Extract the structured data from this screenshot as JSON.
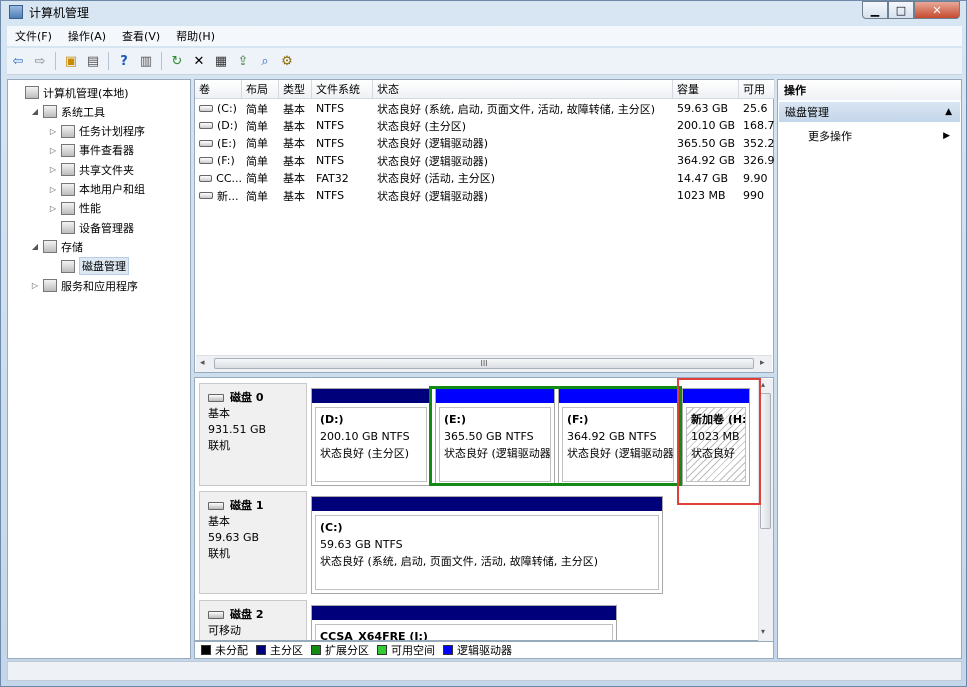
{
  "window": {
    "title": "计算机管理"
  },
  "menu": [
    "文件(F)",
    "操作(A)",
    "查看(V)",
    "帮助(H)"
  ],
  "tree": [
    {
      "label": "计算机管理(本地)",
      "indent": 0,
      "expander": "",
      "icon": "computer-management-icon"
    },
    {
      "label": "系统工具",
      "indent": 1,
      "expander": "◢",
      "icon": "system-tools-icon"
    },
    {
      "label": "任务计划程序",
      "indent": 2,
      "expander": "▷",
      "icon": "task-scheduler-icon"
    },
    {
      "label": "事件查看器",
      "indent": 2,
      "expander": "▷",
      "icon": "event-viewer-icon"
    },
    {
      "label": "共享文件夹",
      "indent": 2,
      "expander": "▷",
      "icon": "shared-folders-icon"
    },
    {
      "label": "本地用户和组",
      "indent": 2,
      "expander": "▷",
      "icon": "local-users-icon"
    },
    {
      "label": "性能",
      "indent": 2,
      "expander": "▷",
      "icon": "performance-icon"
    },
    {
      "label": "设备管理器",
      "indent": 2,
      "expander": "",
      "icon": "device-manager-icon"
    },
    {
      "label": "存储",
      "indent": 1,
      "expander": "◢",
      "icon": "storage-icon"
    },
    {
      "label": "磁盘管理",
      "indent": 2,
      "expander": "",
      "icon": "disk-management-icon",
      "selected": true
    },
    {
      "label": "服务和应用程序",
      "indent": 1,
      "expander": "▷",
      "icon": "services-icon"
    }
  ],
  "volume_table": {
    "columns": [
      "卷",
      "布局",
      "类型",
      "文件系统",
      "状态",
      "容量",
      "可用"
    ],
    "rows": [
      [
        "(C:)",
        "简单",
        "基本",
        "NTFS",
        "状态良好 (系统, 启动, 页面文件, 活动, 故障转储, 主分区)",
        "59.63 GB",
        "25.6"
      ],
      [
        "(D:)",
        "简单",
        "基本",
        "NTFS",
        "状态良好 (主分区)",
        "200.10 GB",
        "168.7"
      ],
      [
        "(E:)",
        "简单",
        "基本",
        "NTFS",
        "状态良好 (逻辑驱动器)",
        "365.50 GB",
        "352.2"
      ],
      [
        "(F:)",
        "简单",
        "基本",
        "NTFS",
        "状态良好 (逻辑驱动器)",
        "364.92 GB",
        "326.9"
      ],
      [
        "CC...",
        "简单",
        "基本",
        "FAT32",
        "状态良好 (活动, 主分区)",
        "14.47 GB",
        "9.90"
      ],
      [
        "新...",
        "简单",
        "基本",
        "NTFS",
        "状态良好 (逻辑驱动器)",
        "1023 MB",
        "990"
      ]
    ],
    "scroll_grip": "III"
  },
  "disks": [
    {
      "name": "磁盘 0",
      "type": "基本",
      "size": "931.51 GB",
      "status": "联机",
      "partitions": [
        {
          "name": "(D:)",
          "size": "200.10 GB NTFS",
          "status": "状态良好 (主分区)"
        },
        {
          "name": "(E:)",
          "size": "365.50 GB NTFS",
          "status": "状态良好 (逻辑驱动器)"
        },
        {
          "name": "(F:)",
          "size": "364.92 GB NTFS",
          "status": "状态良好 (逻辑驱动器)"
        },
        {
          "name": "新加卷  (H:)",
          "size": "1023 MB",
          "status": "状态良好"
        }
      ]
    },
    {
      "name": "磁盘 1",
      "type": "基本",
      "size": "59.63 GB",
      "status": "联机",
      "partitions": [
        {
          "name": "(C:)",
          "size": "59.63 GB NTFS",
          "status": "状态良好 (系统, 启动, 页面文件, 活动, 故障转储, 主分区)"
        }
      ]
    },
    {
      "name": "磁盘 2",
      "type": "可移动",
      "size": "",
      "status": "",
      "partitions": [
        {
          "name": "CCSA_X64FRE  (I:)",
          "size": "",
          "status": ""
        }
      ]
    }
  ],
  "legend": [
    {
      "label": "未分配",
      "color": "#000000"
    },
    {
      "label": "主分区",
      "color": "#000080"
    },
    {
      "label": "扩展分区",
      "color": "#138a13"
    },
    {
      "label": "可用空间",
      "color": "#32cd32"
    },
    {
      "label": "逻辑驱动器",
      "color": "#0000ff"
    }
  ],
  "actions": {
    "title": "操作",
    "section": "磁盘管理",
    "item": "更多操作"
  },
  "colors": {
    "primary": "#00007b",
    "logical": "#0000ff",
    "extended": "#138a13",
    "highlight": "#e0403a"
  }
}
